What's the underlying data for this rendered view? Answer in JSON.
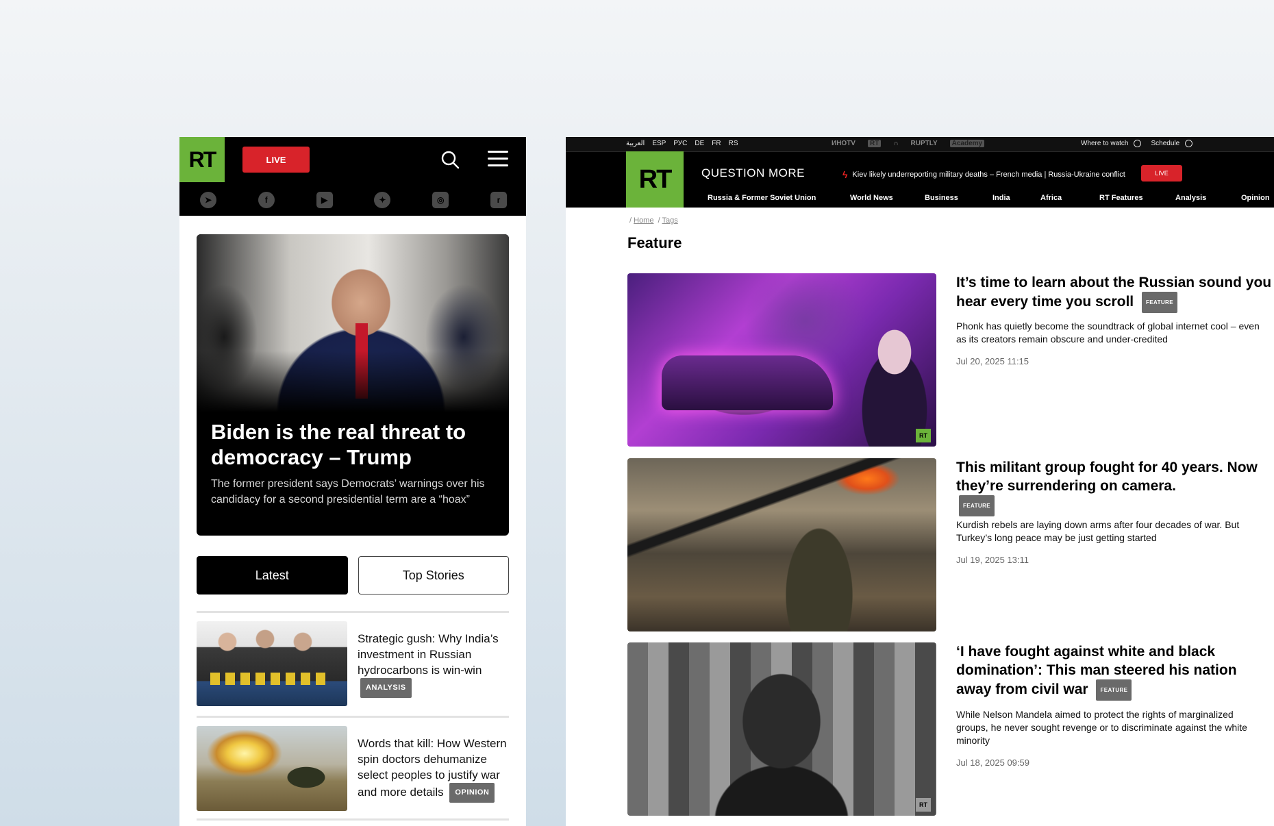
{
  "mobile": {
    "logo": "RT",
    "live_label": "LIVE",
    "social_icons": [
      "telegram-icon",
      "facebook-icon",
      "youtube-icon",
      "twitter-icon",
      "instagram-icon",
      "rumble-icon"
    ],
    "hero": {
      "title": "Biden is the real threat to democracy – Trump",
      "subtitle": "The former president says Democrats’ warnings over his candidacy for a second presidential term are a “hoax”"
    },
    "tabs": [
      {
        "label": "Latest",
        "active": true
      },
      {
        "label": "Top Stories",
        "active": false
      }
    ],
    "items": [
      {
        "title": "Strategic gush: Why India’s investment in Russian hydrocarbons is win-win",
        "badge": "ANALYSIS"
      },
      {
        "title": "Words that kill: How Western spin doctors dehumanize select peoples to justify war and more details",
        "badge": "OPINION"
      }
    ]
  },
  "desktop": {
    "languages": [
      "العربية",
      "ESP",
      "РУС",
      "DE",
      "FR",
      "RS"
    ],
    "brands": [
      "ИНОТV",
      "RT",
      "RUPTLY",
      "Academy"
    ],
    "where_to_watch": "Where to watch",
    "schedule": "Schedule",
    "logo": "RT",
    "tagline": "QUESTION MORE",
    "breaking": "Kiev likely underreporting military deaths – French media | Russia-Ukraine conflict",
    "live_label": "LIVE",
    "nav": [
      "Russia & Former Soviet Union",
      "World News",
      "Business",
      "India",
      "Africa",
      "RT Features",
      "Analysis",
      "Opinion"
    ],
    "breadcrumb": [
      "Home",
      "Tags"
    ],
    "page_title": "Feature",
    "articles": [
      {
        "title": "It’s time to learn about the Russian sound you hear every time you scroll",
        "badge": "FEATURE",
        "summary": "Phonk has quietly become the soundtrack of global internet cool – even as its creators remain obscure and under-credited",
        "date": "Jul 20, 2025 11:15"
      },
      {
        "title": "This militant group fought for 40 years. Now they’re surrendering on camera.",
        "badge": "FEATURE",
        "summary": "Kurdish rebels are laying down arms after four decades of war. But Turkey’s long peace may be just getting started",
        "date": "Jul 19, 2025 13:11"
      },
      {
        "title": "‘I have fought against white and black domination’: This man steered his nation away from civil war",
        "badge": "FEATURE",
        "summary": "While Nelson Mandela aimed to protect the rights of marginalized groups, he never sought revenge or to discriminate against the white minority",
        "date": "Jul 18, 2025 09:59"
      }
    ]
  }
}
